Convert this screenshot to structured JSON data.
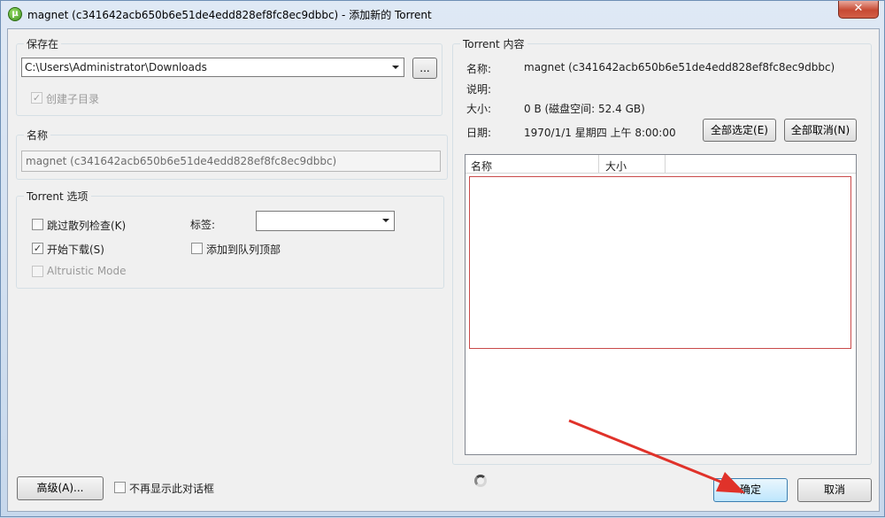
{
  "window": {
    "title": "magnet (c341642acb650b6e51de4edd828ef8fc8ec9dbbc) - 添加新的 Torrent",
    "app_icon_glyph": "µ",
    "close_glyph": "✕"
  },
  "save_in": {
    "label": "保存在",
    "path": "C:\\Users\\Administrator\\Downloads",
    "browse_label": "...",
    "create_subdir_label": "创建子目录",
    "create_subdir_checked": true
  },
  "name_group": {
    "label": "名称",
    "value": "magnet (c341642acb650b6e51de4edd828ef8fc8ec9dbbc)"
  },
  "torrent_options": {
    "label": "Torrent 选项",
    "skip_hash_label": "跳过散列检查(K)",
    "start_download_label": "开始下载(S)",
    "altruistic_label": "Altruistic Mode",
    "tag_label": "标签:",
    "tag_value": "",
    "add_to_queue_top_label": "添加到队列顶部",
    "check_glyph": "✓"
  },
  "torrent_content": {
    "label": "Torrent 内容",
    "name_key": "名称:",
    "name_value": "magnet (c341642acb650b6e51de4edd828ef8fc8ec9dbbc)",
    "desc_key": "说明:",
    "desc_value": "",
    "size_key": "大小:",
    "size_value": "0 B (磁盘空间: 52.4 GB)",
    "date_key": "日期:",
    "date_value": "1970/1/1 星期四 上午 8:00:00",
    "select_all_label": "全部选定(E)",
    "deselect_all_label": "全部取消(N)",
    "columns": [
      "名称",
      "大小"
    ]
  },
  "footer": {
    "advanced_label": "高级(A)...",
    "dont_show_label": "不再显示此对话框",
    "ok_label": "确定",
    "cancel_label": "取消"
  },
  "colors": {
    "annotation_arrow": "#e0322a"
  }
}
